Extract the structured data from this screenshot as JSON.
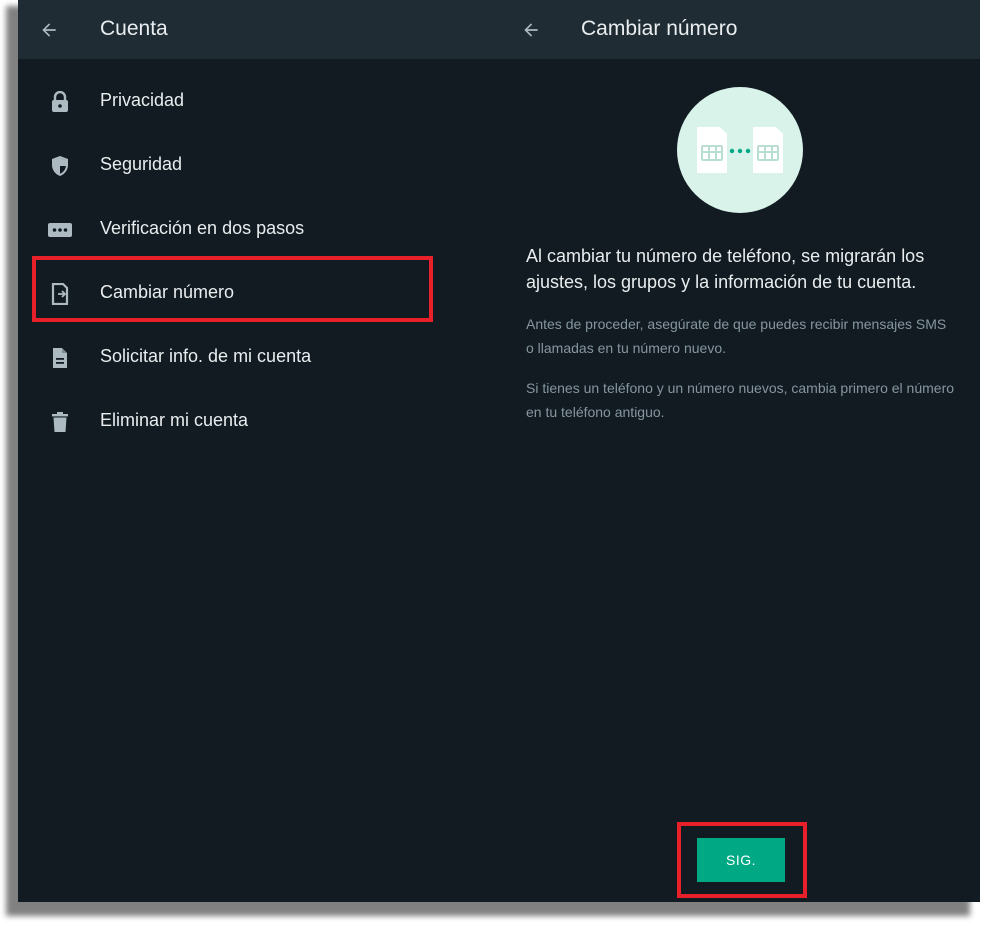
{
  "left_panel": {
    "title": "Cuenta",
    "items": [
      {
        "label": "Privacidad",
        "icon": "lock-icon"
      },
      {
        "label": "Seguridad",
        "icon": "shield-icon"
      },
      {
        "label": "Verificación en dos pasos",
        "icon": "dots-password-icon"
      },
      {
        "label": "Cambiar número",
        "icon": "sim-swap-icon"
      },
      {
        "label": "Solicitar info. de mi cuenta",
        "icon": "document-icon"
      },
      {
        "label": "Eliminar mi cuenta",
        "icon": "trash-icon"
      }
    ]
  },
  "right_panel": {
    "title": "Cambiar número",
    "main_text": "Al cambiar tu número de teléfono, se migrarán los ajustes, los grupos y la información de tu cuenta.",
    "sub_text_1": "Antes de proceder, asegúrate de que puedes recibir mensajes SMS o llamadas en tu número nuevo.",
    "sub_text_2": "Si tienes un teléfono y un número nuevos, cambia primero el número en tu teléfono antiguo.",
    "next_button": "SIG."
  },
  "colors": {
    "background": "#111b21",
    "header": "#1f2c34",
    "accent": "#00a884",
    "highlight": "#e8202a",
    "icon": "#aebac1",
    "illustration_bg": "#d9f2ea"
  }
}
